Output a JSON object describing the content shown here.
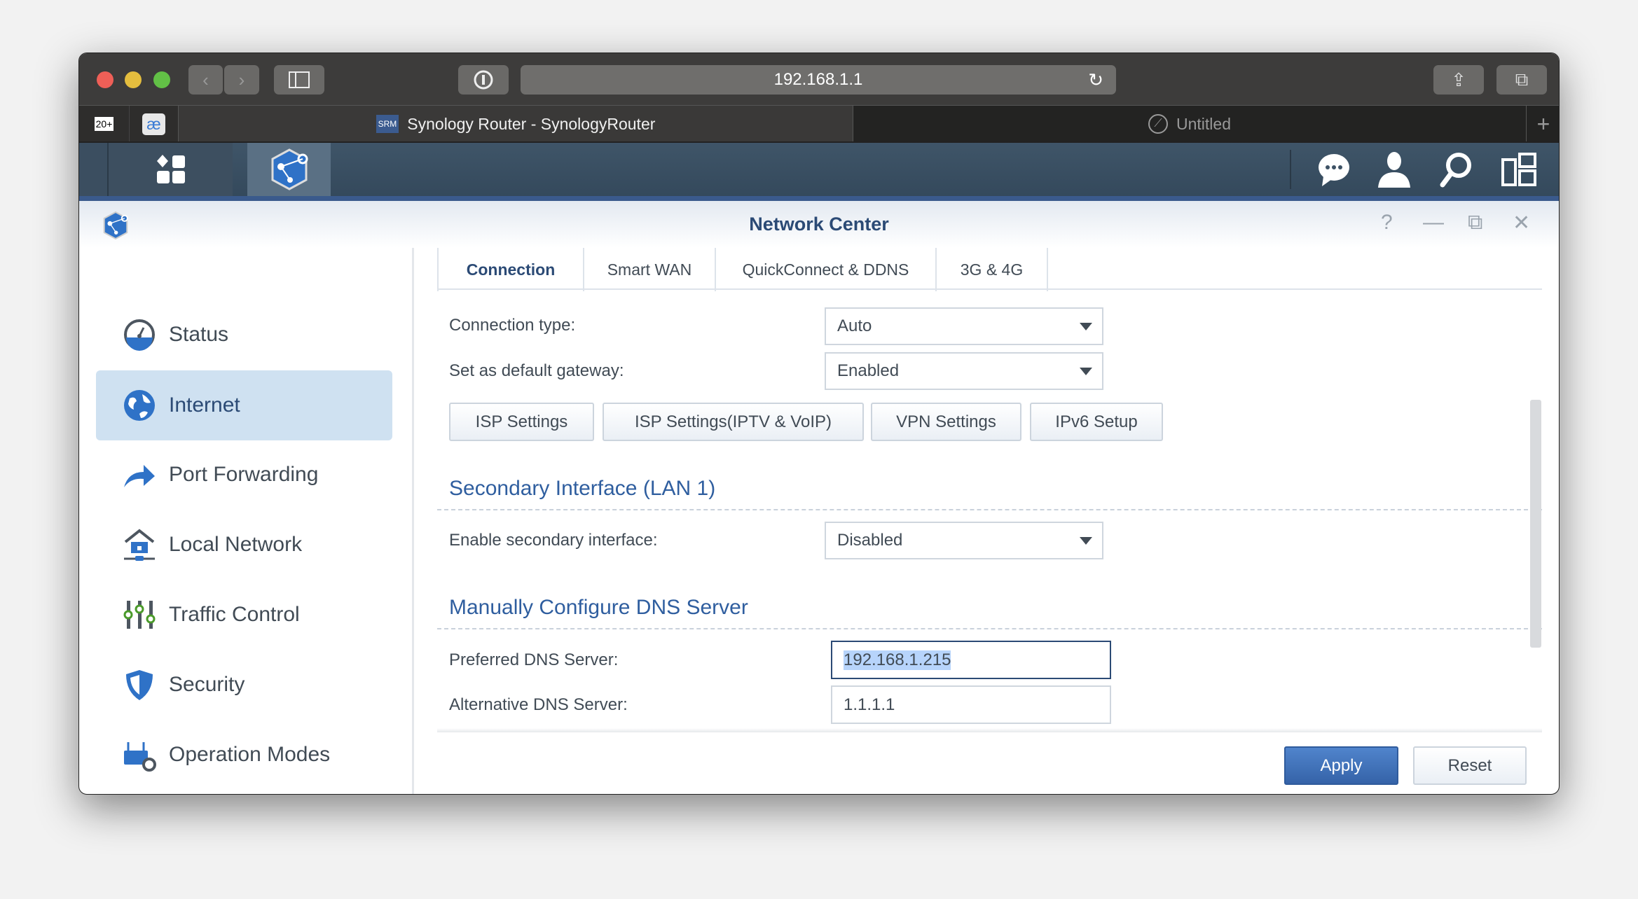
{
  "browser": {
    "url": "192.168.1.1",
    "tabs": [
      {
        "label": "Synology Router - SynologyRouter",
        "favicon": "SRM",
        "active": true
      },
      {
        "label": "Untitled",
        "active": false
      }
    ],
    "pinned": [
      {
        "label": "20+",
        "icon": "gmail-icon"
      },
      {
        "label": "æ",
        "icon": "ae-icon"
      }
    ]
  },
  "app": {
    "title": "Network Center",
    "accent": "#3a5a8c"
  },
  "sidebar": {
    "items": [
      {
        "label": "Status",
        "icon": "gauge-icon"
      },
      {
        "label": "Internet",
        "icon": "globe-icon",
        "selected": true
      },
      {
        "label": "Port Forwarding",
        "icon": "forward-arrow-icon"
      },
      {
        "label": "Local Network",
        "icon": "house-network-icon"
      },
      {
        "label": "Traffic Control",
        "icon": "sliders-icon"
      },
      {
        "label": "Security",
        "icon": "shield-icon"
      },
      {
        "label": "Operation Modes",
        "icon": "router-gear-icon"
      }
    ]
  },
  "tabs": [
    {
      "label": "Connection",
      "active": true
    },
    {
      "label": "Smart WAN"
    },
    {
      "label": "QuickConnect & DDNS"
    },
    {
      "label": "3G & 4G"
    }
  ],
  "form": {
    "connection_type": {
      "label": "Connection type:",
      "value": "Auto"
    },
    "default_gateway": {
      "label": "Set as default gateway:",
      "value": "Enabled"
    },
    "buttons": [
      "ISP Settings",
      "ISP Settings(IPTV & VoIP)",
      "VPN Settings",
      "IPv6 Setup"
    ],
    "secondary": {
      "heading": "Secondary Interface (LAN 1)",
      "label": "Enable secondary interface:",
      "value": "Disabled"
    },
    "dns": {
      "heading": "Manually Configure DNS Server",
      "preferred_label": "Preferred DNS Server:",
      "preferred_value": "192.168.1.215",
      "alternative_label": "Alternative DNS Server:",
      "alternative_value": "1.1.1.1"
    }
  },
  "footer": {
    "apply": "Apply",
    "reset": "Reset"
  }
}
